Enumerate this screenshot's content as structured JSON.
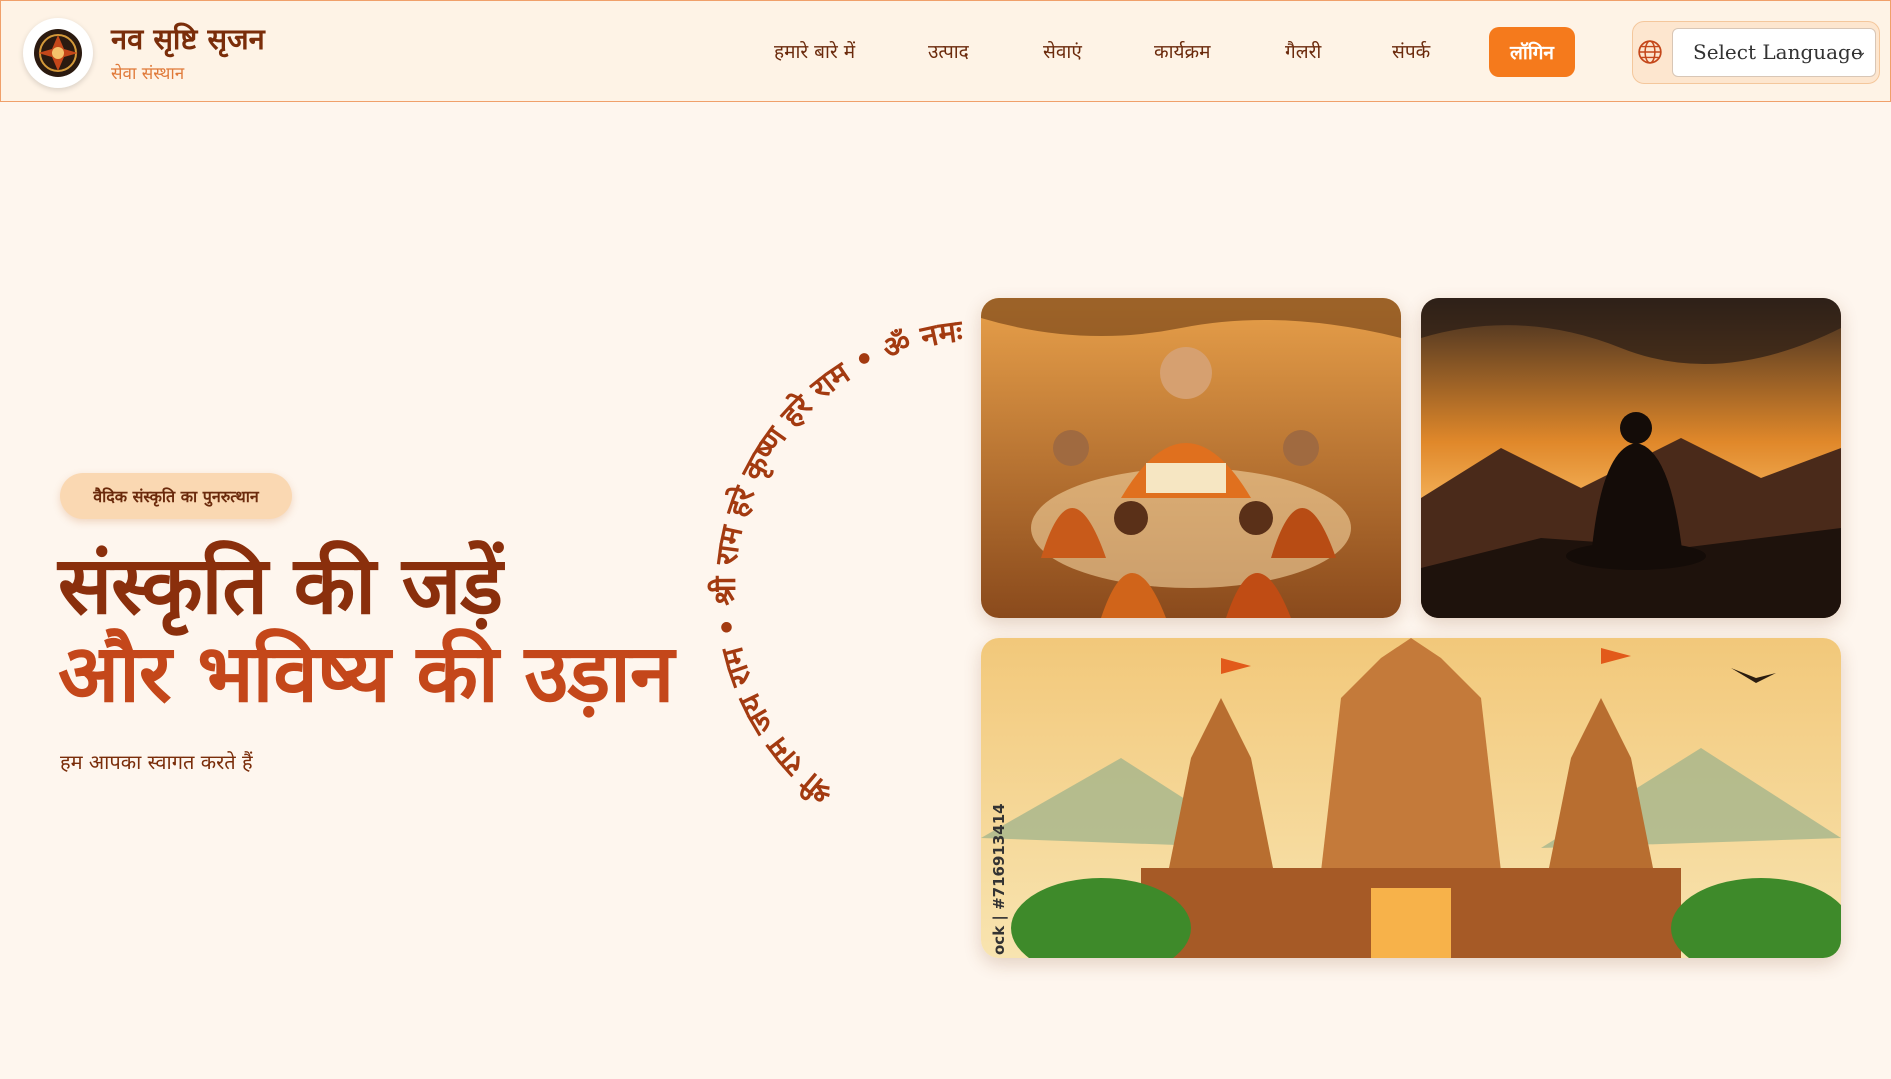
{
  "header": {
    "brand_title": "नव सृष्टि सृजन",
    "brand_subtitle": "सेवा संस्थान",
    "nav": [
      {
        "label": "हमारे बारे में"
      },
      {
        "label": "उत्पाद"
      },
      {
        "label": "सेवाएं"
      },
      {
        "label": "कार्यक्रम"
      },
      {
        "label": "गैलरी"
      },
      {
        "label": "संपर्क"
      }
    ],
    "login_label": "लॉगिन",
    "language_select": "Select Language",
    "accent_color": "#f57a1c"
  },
  "hero": {
    "pill": "वैदिक संस्कृति का पुनरुत्थान",
    "title_line1": "संस्कृति की जड़ें",
    "title_line2": "और भविष्य की उड़ान",
    "subtitle": "हम आपका स्वागत करते हैं",
    "ring_text": "श्री राम जय राम • श्री राम हरे कृष्ण हरे राम • ॐ नमः शिवाय •"
  },
  "gallery": {
    "watermark": "ock | #716913414",
    "images": [
      {
        "icon": "guru-teaching-children-image"
      },
      {
        "icon": "meditation-sunset-image"
      },
      {
        "icon": "temple-image"
      }
    ]
  }
}
